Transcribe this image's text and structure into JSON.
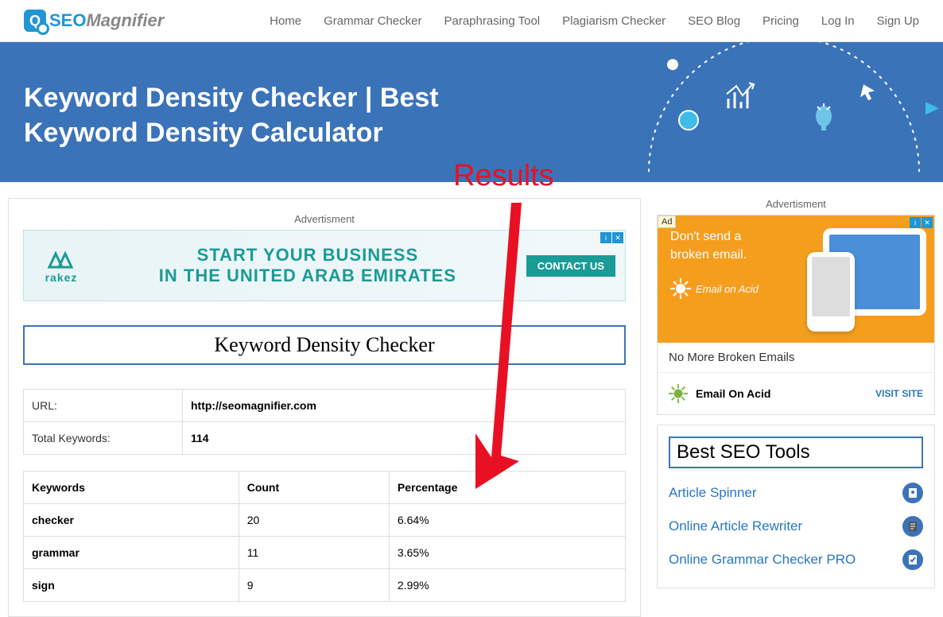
{
  "logo": {
    "seo": "SEO",
    "magnifier": "Magnifier"
  },
  "nav": [
    {
      "label": "Home"
    },
    {
      "label": "Grammar Checker"
    },
    {
      "label": "Paraphrasing Tool"
    },
    {
      "label": "Plagiarism Checker"
    },
    {
      "label": "SEO Blog"
    },
    {
      "label": "Pricing"
    },
    {
      "label": "Log In"
    },
    {
      "label": "Sign Up"
    }
  ],
  "hero": {
    "title": "Keyword Density Checker | Best Keyword Density Calculator"
  },
  "annotation": {
    "text": "Results"
  },
  "main": {
    "ad_label": "Advertisment",
    "ad_banner": {
      "brand": "rakez",
      "line1": "START YOUR BUSINESS",
      "line2": "IN THE UNITED ARAB EMIRATES",
      "cta": "CONTACT US"
    },
    "tool_title": "Keyword Density Checker",
    "info": [
      {
        "label": "URL:",
        "value": "http://seomagnifier.com"
      },
      {
        "label": "Total Keywords:",
        "value": "114"
      }
    ],
    "table": {
      "headers": [
        "Keywords",
        "Count",
        "Percentage"
      ],
      "rows": [
        {
          "keyword": "checker",
          "count": "20",
          "percentage": "6.64%"
        },
        {
          "keyword": "grammar",
          "count": "11",
          "percentage": "3.65%"
        },
        {
          "keyword": "sign",
          "count": "9",
          "percentage": "2.99%"
        }
      ]
    }
  },
  "sidebar": {
    "ad_label": "Advertisment",
    "ad": {
      "badge": "Ad",
      "headline": "Don't send a broken email.",
      "brand_inline": "Email on Acid",
      "title": "No More Broken Emails",
      "brand": "Email On Acid",
      "visit": "VISIT SITE"
    },
    "tools_title": "Best SEO Tools",
    "tools": [
      {
        "label": "Article Spinner"
      },
      {
        "label": "Online Article Rewriter"
      },
      {
        "label": "Online Grammar Checker PRO"
      }
    ]
  }
}
